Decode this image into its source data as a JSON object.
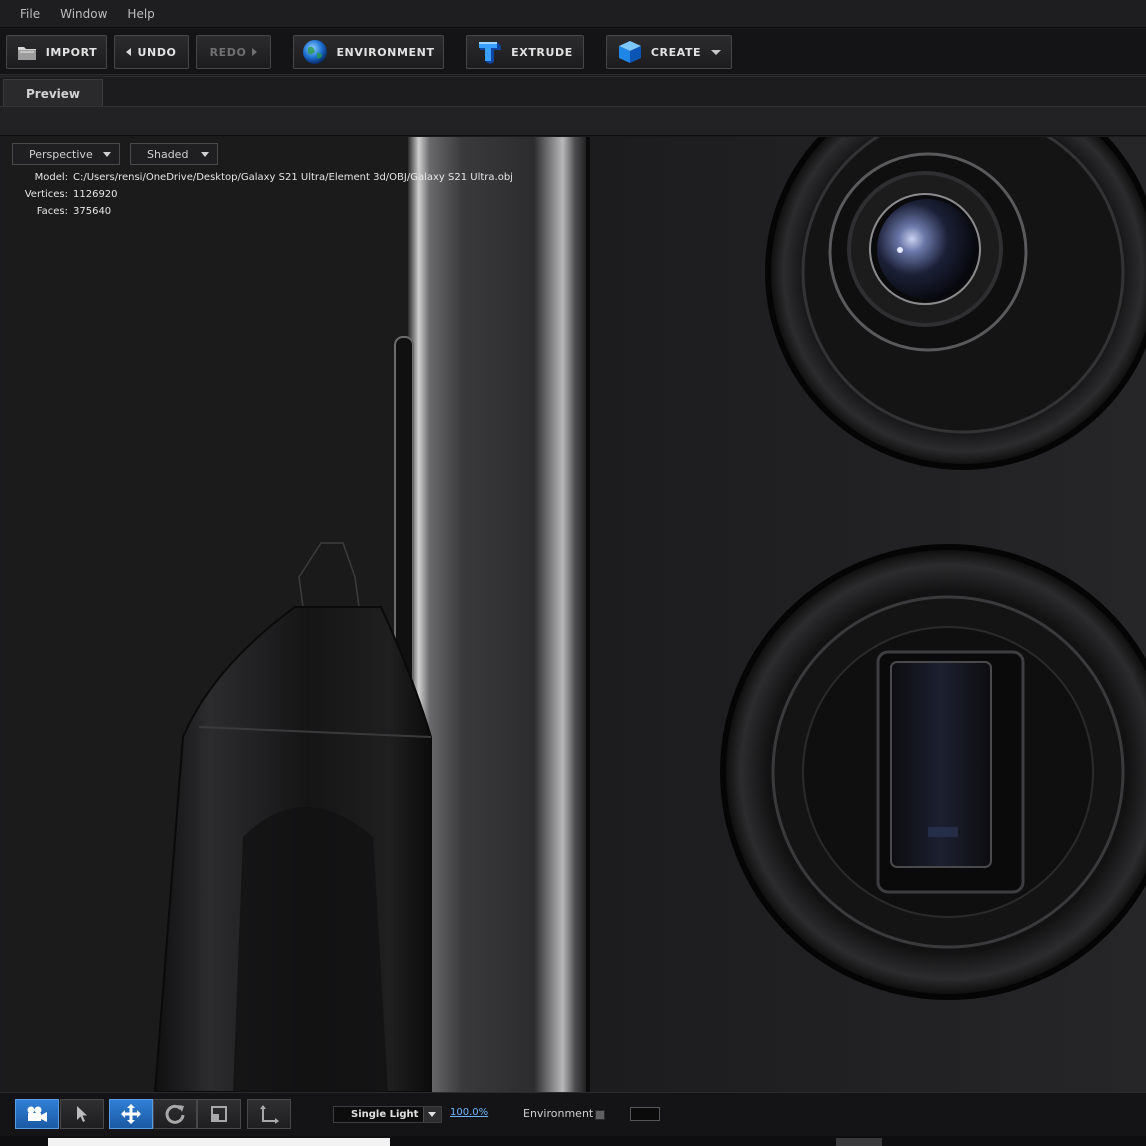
{
  "menu": [
    "File",
    "Window",
    "Help"
  ],
  "toolbar": {
    "import_label": "IMPORT",
    "undo_label": "UNDO",
    "redo_label": "REDO",
    "environment_label": "ENVIRONMENT",
    "extrude_label": "EXTRUDE",
    "create_label": "CREATE"
  },
  "tabs": {
    "preview": "Preview"
  },
  "viewport": {
    "camera_mode": "Perspective",
    "shading_mode": "Shaded",
    "model_label": "Model:",
    "model_path": "C:/Users/rensi/OneDrive/Desktop/Galaxy S21 Ultra/Element 3d/OBJ/Galaxy S21 Ultra.obj",
    "vertices_label": "Vertices:",
    "vertices": "1126920",
    "faces_label": "Faces:",
    "faces": "375640"
  },
  "bottom": {
    "light_mode": "Single Light",
    "zoom": "100.0%",
    "environment_label": "Environment"
  },
  "colors": {
    "accent_blue": "#2f7fd6",
    "zoom_link": "#6fb4ff"
  }
}
